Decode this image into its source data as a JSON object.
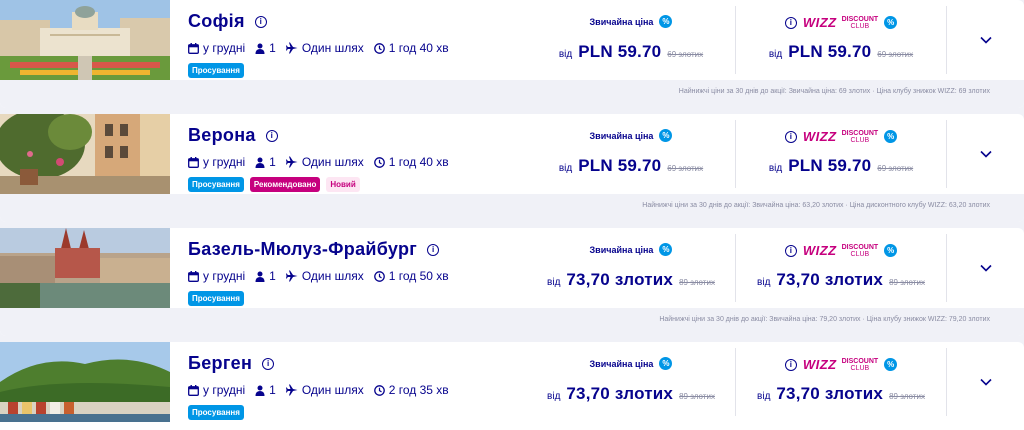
{
  "labels": {
    "standard_price": "Звичайна ціна",
    "percent_sign": "%",
    "from": "від",
    "wizz_logo": "WIZZ",
    "wizz_discount": "DISCOUNT",
    "wizz_club": "CLUB",
    "info_glyph": "i"
  },
  "colors": {
    "navy": "#06038d",
    "magenta": "#c6007e",
    "blue": "#0096e6",
    "bg": "#f0f1f7"
  },
  "cards": [
    {
      "city": "Софія",
      "month": "у грудні",
      "passengers": "1",
      "trip": "Один шлях",
      "duration": "1 год 40 хв",
      "badges": {
        "promo": "Просування",
        "recommended": "",
        "new": ""
      },
      "standard_price": "PLN 59.70",
      "standard_old": "69 злотих",
      "club_price": "PLN 59.70",
      "club_old": "69 злотих",
      "lowest_note": "Найнижчі ціни за 30 днів до акції: Звичайна ціна: 69 злотих · Ціна клубу знижок WIZZ: 69 злотих"
    },
    {
      "city": "Верона",
      "month": "у грудні",
      "passengers": "1",
      "trip": "Один шлях",
      "duration": "1 год 40 хв",
      "badges": {
        "promo": "Просування",
        "recommended": "Рекомендовано",
        "new": "Новий"
      },
      "standard_price": "PLN 59.70",
      "standard_old": "69 злотих",
      "club_price": "PLN 59.70",
      "club_old": "69 злотих",
      "lowest_note": "Найнижчі ціни за 30 днів до акції: Звичайна ціна: 63,20 злотих · Ціна дисконтного клубу WIZZ: 63,20 злотих"
    },
    {
      "city": "Базель-Мюлуз-Фрайбург",
      "month": "у грудні",
      "passengers": "1",
      "trip": "Один шлях",
      "duration": "1 год 50 хв",
      "badges": {
        "promo": "Просування",
        "recommended": "",
        "new": ""
      },
      "standard_price": "73,70 злотих",
      "standard_old": "89 злотих",
      "club_price": "73,70 злотих",
      "club_old": "89 злотих",
      "lowest_note": "Найнижчі ціни за 30 днів до акції: Звичайна ціна: 79,20 злотих · Ціна клубу знижок WIZZ: 79,20 злотих"
    },
    {
      "city": "Берген",
      "month": "у грудні",
      "passengers": "1",
      "trip": "Один шлях",
      "duration": "2 год 35 хв",
      "badges": {
        "promo": "Просування",
        "recommended": "",
        "new": ""
      },
      "standard_price": "73,70 злотих",
      "standard_old": "89 злотих",
      "club_price": "73,70 злотих",
      "club_old": "89 злотих",
      "lowest_note": ""
    }
  ]
}
